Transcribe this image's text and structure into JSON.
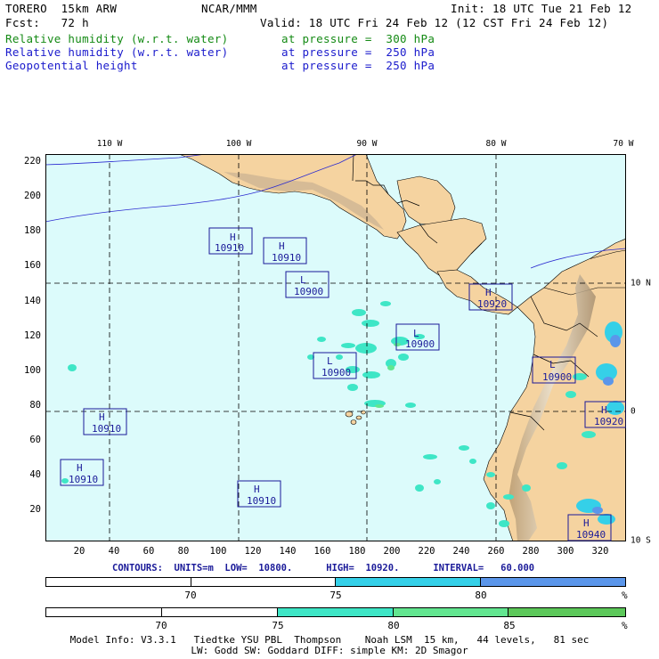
{
  "header": {
    "model": "TORERO  15km ARW",
    "center": "NCAR/MMM",
    "init": "Init: 18 UTC Tue 21 Feb 12",
    "fcst": "Fcst:   72 h",
    "valid": "Valid: 18 UTC Fri 24 Feb 12 (12 CST Fri 24 Feb 12)",
    "fields": [
      {
        "name": "Relative humidity (w.r.t. water)",
        "level": "at pressure =  300 hPa",
        "color": "#148a14"
      },
      {
        "name": "Relative humidity (w.r.t. water)",
        "level": "at pressure =  250 hPa",
        "color": "#1a1acc"
      },
      {
        "name": "Geopotential height",
        "level": "at pressure =  250 hPa",
        "color": "#1a1acc"
      }
    ]
  },
  "map": {
    "longitude_labels": [
      "110 W",
      "100 W",
      "90 W",
      "80 W",
      "70 W"
    ],
    "latitude_labels": [
      "10 N",
      "0",
      "10 S"
    ],
    "y_ticks": [
      "220",
      "200",
      "180",
      "160",
      "140",
      "120",
      "100",
      "80",
      "60",
      "40",
      "20"
    ],
    "x_ticks": [
      "20",
      "40",
      "60",
      "80",
      "100",
      "120",
      "140",
      "160",
      "180",
      "200",
      "220",
      "240",
      "260",
      "280",
      "300",
      "320"
    ],
    "pressure_centers": [
      {
        "type": "H",
        "value": "10910"
      },
      {
        "type": "H",
        "value": "10910"
      },
      {
        "type": "L",
        "value": "10900"
      },
      {
        "type": "H",
        "value": "10920"
      },
      {
        "type": "L",
        "value": "10900"
      },
      {
        "type": "L",
        "value": "10900"
      },
      {
        "type": "L",
        "value": "10900"
      },
      {
        "type": "H",
        "value": "10910"
      },
      {
        "type": "H",
        "value": "10920"
      },
      {
        "type": "H",
        "value": "10910"
      },
      {
        "type": "H",
        "value": "10910"
      },
      {
        "type": "H",
        "value": "10940"
      }
    ]
  },
  "contours": "CONTOURS:  UNITS=m  LOW=  10800.      HIGH=  10920.      INTERVAL=   60.000",
  "colorbar_250": {
    "labels": [
      "70",
      "75",
      "80",
      "%"
    ],
    "colors": [
      "#ffffff",
      "#ffffff",
      "#35d0e8",
      "#5b96ea"
    ]
  },
  "colorbar_300": {
    "labels": [
      "70",
      "75",
      "80",
      "85",
      "%"
    ],
    "colors": [
      "#ffffff",
      "#ffffff",
      "#3ee6c6",
      "#62e690",
      "#5cc85a"
    ]
  },
  "footer": {
    "line1": "Model Info: V3.3.1   Tiedtke YSU PBL  Thompson    Noah LSM  15 km,   44 levels,   81 sec",
    "line2": "LW: Godd SW: Goddard DIFF: simple KM: 2D Smagor"
  }
}
